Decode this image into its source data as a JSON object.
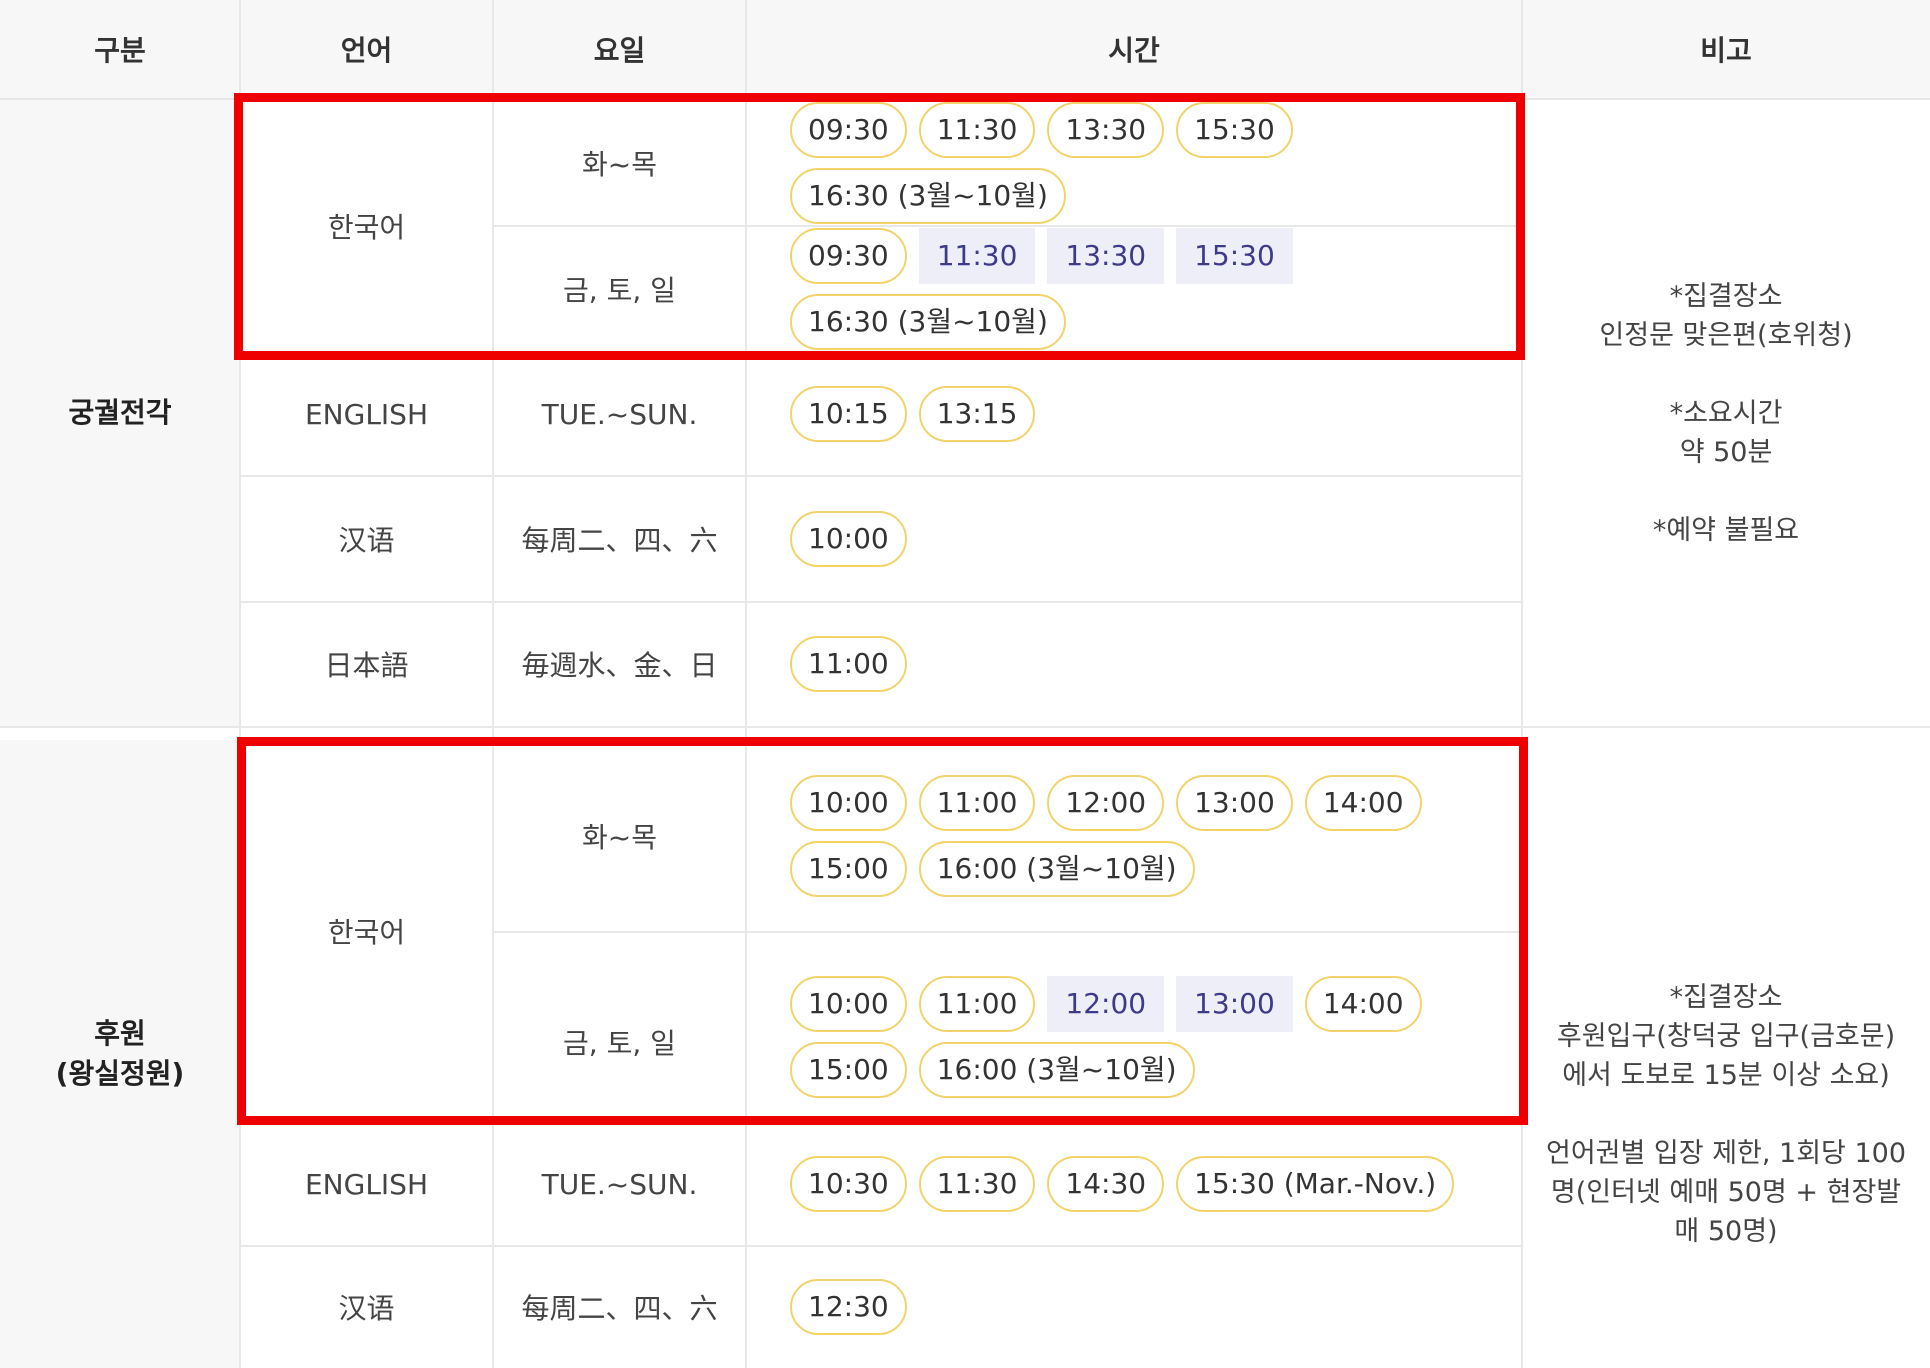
{
  "header": {
    "c1": "구분",
    "c2": "언어",
    "c3": "요일",
    "c4": "시간",
    "c5": "비고"
  },
  "palace": {
    "category": "궁궐전각",
    "note": "*집결장소\n인정문 맞은편(호위청)\n\n*소요시간\n약 50분\n\n*예약 불필요",
    "rows": [
      {
        "lang": "한국어",
        "day": "화~목",
        "times": [
          {
            "t": "09:30",
            "sold": false
          },
          {
            "t": "11:30",
            "sold": false
          },
          {
            "t": "13:30",
            "sold": false
          },
          {
            "t": "15:30",
            "sold": false
          },
          {
            "t": "16:30 (3월~10월)",
            "sold": false
          }
        ]
      },
      {
        "lang": "",
        "day": "금, 토, 일",
        "times": [
          {
            "t": "09:30",
            "sold": false
          },
          {
            "t": "11:30",
            "sold": true
          },
          {
            "t": "13:30",
            "sold": true
          },
          {
            "t": "15:30",
            "sold": true
          },
          {
            "t": "16:30 (3월~10월)",
            "sold": false
          }
        ]
      },
      {
        "lang": "ENGLISH",
        "day": "TUE.~SUN.",
        "times": [
          {
            "t": "10:15",
            "sold": false
          },
          {
            "t": "13:15",
            "sold": false
          }
        ]
      },
      {
        "lang": "汉语",
        "day": "每周二、四、六",
        "times": [
          {
            "t": "10:00",
            "sold": false
          }
        ]
      },
      {
        "lang": "日本語",
        "day": "毎週水、金、日",
        "times": [
          {
            "t": "11:00",
            "sold": false
          }
        ]
      }
    ]
  },
  "garden": {
    "category": "후원\n(왕실정원)",
    "note": "*집결장소\n후원입구(창덕궁 입구(금호문)\n에서 도보로 15분 이상 소요)\n\n언어권별 입장 제한, 1회당 100\n명(인터넷 예매 50명 + 현장발\n매 50명)",
    "rows": [
      {
        "lang": "한국어",
        "day": "화~목",
        "times": [
          {
            "t": "10:00",
            "sold": false
          },
          {
            "t": "11:00",
            "sold": false
          },
          {
            "t": "12:00",
            "sold": false
          },
          {
            "t": "13:00",
            "sold": false
          },
          {
            "t": "14:00",
            "sold": false
          },
          {
            "t": "15:00",
            "sold": false
          },
          {
            "t": "16:00 (3월~10월)",
            "sold": false
          }
        ]
      },
      {
        "lang": "",
        "day": "금, 토, 일",
        "times": [
          {
            "t": "10:00",
            "sold": false
          },
          {
            "t": "11:00",
            "sold": false
          },
          {
            "t": "12:00",
            "sold": true
          },
          {
            "t": "13:00",
            "sold": true
          },
          {
            "t": "14:00",
            "sold": false
          },
          {
            "t": "15:00",
            "sold": false
          },
          {
            "t": "16:00 (3월~10월)",
            "sold": false
          }
        ]
      },
      {
        "lang": "ENGLISH",
        "day": "TUE.~SUN.",
        "times": [
          {
            "t": "10:30",
            "sold": false
          },
          {
            "t": "11:30",
            "sold": false
          },
          {
            "t": "14:30",
            "sold": false
          },
          {
            "t": "15:30 (Mar.-Nov.)",
            "sold": false
          }
        ]
      },
      {
        "lang": "汉语",
        "day": "每周二、四、六",
        "times": [
          {
            "t": "12:30",
            "sold": false
          }
        ]
      }
    ]
  },
  "colors": {
    "pill_border": "#f2d36b",
    "sold_bg": "#eeeef8",
    "highlight_box": "#ee0000"
  }
}
